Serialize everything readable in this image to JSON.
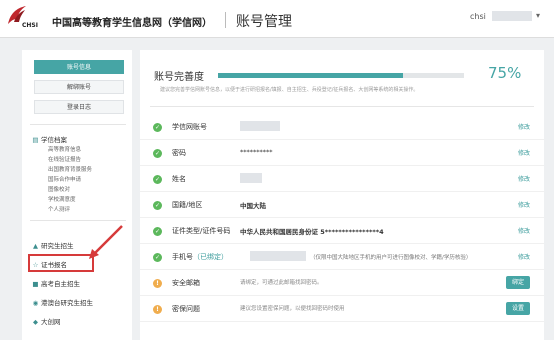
{
  "header": {
    "site_name": "中国高等教育学生信息网（学信网）",
    "logo_text": "CHSI",
    "page_title": "账号管理",
    "user_prefix": "chsi",
    "user_caret": "▾"
  },
  "sidebar": {
    "buttons": [
      "账号信息",
      "解绑账号",
      "登录日志"
    ],
    "groups": [
      {
        "label": "学信档案",
        "icon": "folder-icon",
        "subitems": [
          "高等教育信息",
          "在线验证报告",
          "出国教育背景服务",
          "国际合作申请",
          "图像校对",
          "学校满意度",
          "个人测评"
        ]
      },
      {
        "label": "研究生招生",
        "icon": "grad-cap-icon"
      },
      {
        "label": "证书报名",
        "icon": "certificate-icon"
      },
      {
        "label": "高考自主招生",
        "icon": "exam-icon"
      },
      {
        "label": "港澳台研究生招生",
        "icon": "globe-icon"
      },
      {
        "label": "大创网",
        "icon": "lightbulb-icon"
      }
    ]
  },
  "main": {
    "progress": {
      "label": "账号完善度",
      "value_text": "75%",
      "fraction": 0.75
    },
    "tip": "建议您完善学信网账号信息，以便于进行研招报名/填报、自主招生、兵役登记/征兵报名、大创网等系统的相关操作。",
    "rows": [
      {
        "status": "ok",
        "label": "学信网账号",
        "value": "",
        "action": "修改"
      },
      {
        "status": "ok",
        "label": "密码",
        "value": "**********",
        "action": "修改"
      },
      {
        "status": "ok",
        "label": "姓名",
        "value": "",
        "action": "修改"
      },
      {
        "status": "ok",
        "label": "国籍/地区",
        "value": "中国大陆",
        "action": "修改"
      },
      {
        "status": "ok",
        "label": "证件类型/证件号码",
        "value": "中华人民共和国居民身份证     5****************4",
        "action": "修改"
      },
      {
        "status": "ok",
        "label": "手机号",
        "bound_tag": "（已绑定）",
        "note": "（仅限中国大陆地区手机的用户可进行图像校对、学籍/学历核验）",
        "action": "修改"
      },
      {
        "status": "warn",
        "label": "安全邮箱",
        "value": "请绑定，可通过此邮箱找回密码。",
        "action": "绑定"
      },
      {
        "status": "warn",
        "label": "密保问题",
        "value": "建议您设置密保问题，以便找回密码时使用",
        "action": "设置"
      }
    ]
  },
  "colors": {
    "accent": "#46a5a5",
    "success": "#5cb85c",
    "warning": "#f0ad4e",
    "highlight": "#d63a3a"
  }
}
